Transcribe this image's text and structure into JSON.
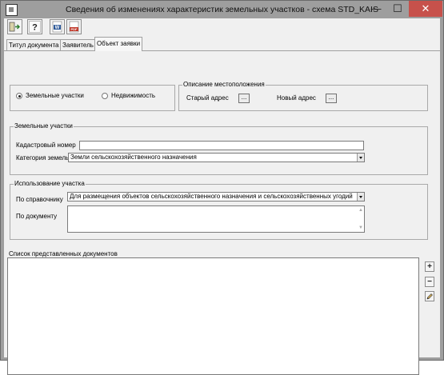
{
  "window": {
    "title": "Сведения об изменениях характеристик земельных участков - схема STD_KAIS",
    "minimize_glyph": "—",
    "maximize_glyph": "☐",
    "close_glyph": "✕"
  },
  "toolbar": {
    "buttons": [
      {
        "name": "exit-icon"
      },
      {
        "name": "help-icon",
        "glyph": "?"
      },
      {
        "name": "word-icon",
        "glyph": "W"
      },
      {
        "name": "pdf-icon",
        "glyph": "PDF"
      }
    ]
  },
  "tabs": [
    {
      "label": "Титул документа",
      "active": false
    },
    {
      "label": "Заявитель",
      "active": false
    },
    {
      "label": "Объект заявки",
      "active": true
    }
  ],
  "object_type": {
    "options": [
      {
        "label": "Земельные участки",
        "checked": true
      },
      {
        "label": "Недвижимость",
        "checked": false
      }
    ]
  },
  "location": {
    "title": "Описание местоположения",
    "old_address_label": "Старый адрес",
    "new_address_label": "Новый адрес",
    "button_label": "..."
  },
  "land_plots": {
    "title": "Земельные участки",
    "cadastral_label": "Кадастровый номер",
    "cadastral_value": "",
    "category_label": "Категория земель",
    "category_value": "Земли сельскохозяйственного назначения"
  },
  "usage": {
    "title": "Использование участка",
    "by_reference_label": "По справочнику",
    "by_reference_value": "Для размещения объектов сельскохозяйственного назначения и сельскохозяйственных угодий",
    "by_document_label": "По документу",
    "by_document_value": ""
  },
  "documents": {
    "title": "Список представленных документов",
    "add_glyph": "+",
    "remove_glyph": "−",
    "edit_icon": "pencil-icon"
  },
  "colors": {
    "title_bar": "#9e9e9e",
    "close_button": "#c7514b",
    "client_bg": "#f0f0f0"
  }
}
